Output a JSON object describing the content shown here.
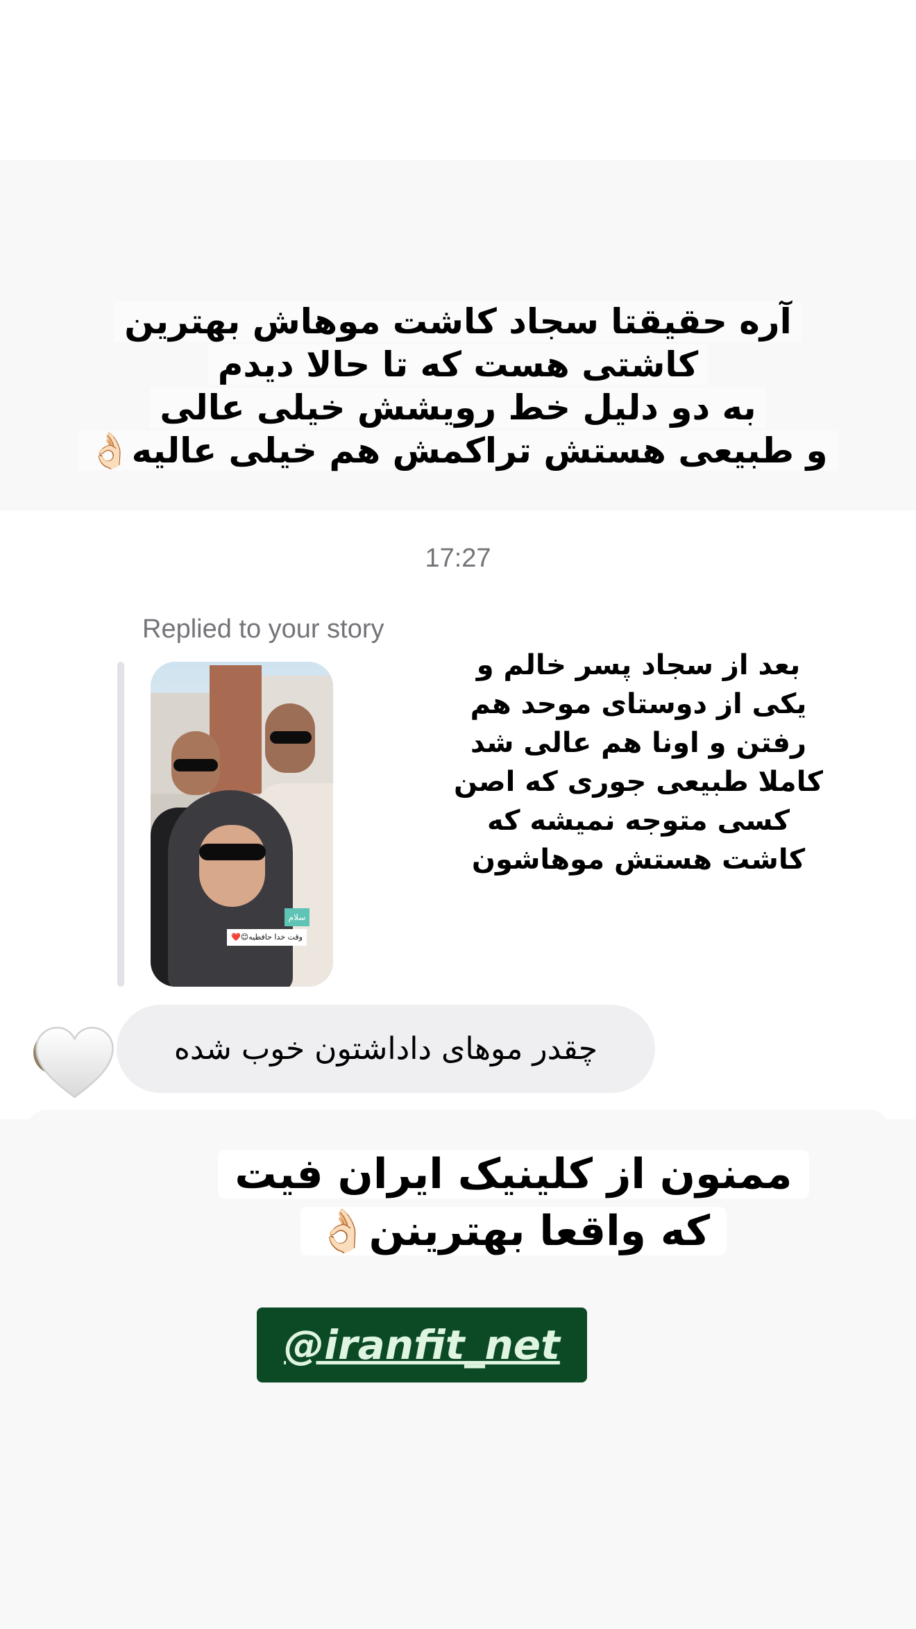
{
  "top_sticker": {
    "lines": [
      "آره حقیقتا سجاد کاشت موهاش بهترین",
      "کاشتی هست که تا حالا دیدم",
      "به دو دلیل خط رویشش خیلی عالی",
      "و طبیعی هستش تراکمش هم خیلی عالیه👌🏻"
    ]
  },
  "timestamp": "17:27",
  "reply": {
    "label": "Replied to your story",
    "story_stickers": {
      "green": "سلام",
      "white": "وقت خدا حافظیه😊❤️"
    },
    "message_lines": [
      "بعد از سجاد پسر خالم و",
      "یکی از دوستای  موحد هم",
      "رفتن و اونا هم عالی شد",
      "کاملا طبیعی جوری که اصن",
      "کسی متوجه نمیشه که",
      "کاشت هستش موهاشون"
    ]
  },
  "incoming_message": {
    "text": "چقدر موهای داداشتون خوب شده",
    "reaction": "white-heart-icon"
  },
  "bottom_sticker": {
    "lines": [
      "ممنون از کلینیک ایران فیت",
      "که واقعا بهترینن👌🏻"
    ]
  },
  "mention": {
    "text": "@iranfit_net",
    "background": "#0b4a24",
    "color": "#dff5e2"
  }
}
